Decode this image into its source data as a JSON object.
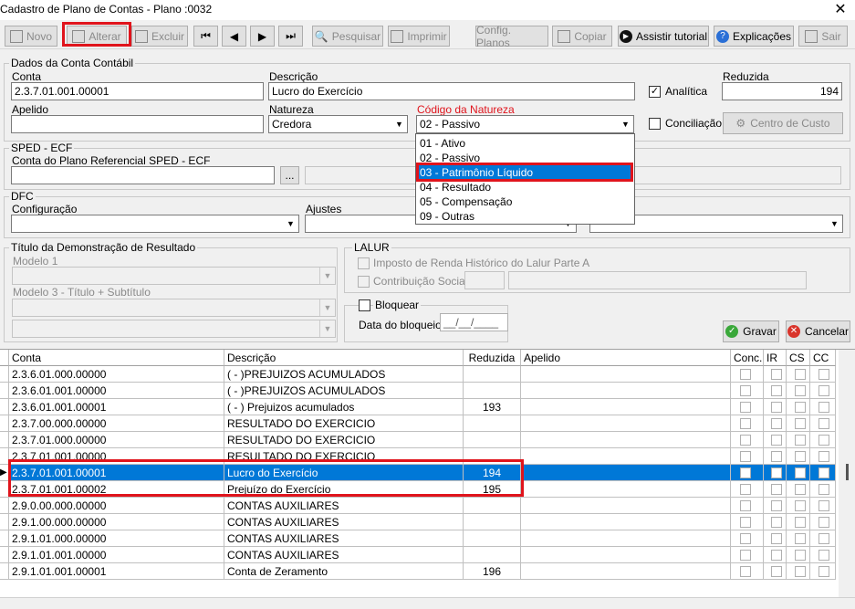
{
  "window": {
    "title": "Cadastro de Plano de Contas - Plano :0032"
  },
  "toolbar": {
    "novo": "Novo",
    "alterar": "Alterar",
    "excluir": "Excluir",
    "pesquisar": "Pesquisar",
    "imprimir": "Imprimir",
    "config": "Config. Planos",
    "copiar": "Copiar",
    "tutorial": "Assistir tutorial",
    "explicacoes": "Explicações",
    "sair": "Sair"
  },
  "dados": {
    "group": "Dados da Conta Contábil",
    "conta_label": "Conta",
    "conta": "2.3.7.01.001.00001",
    "descricao_label": "Descrição",
    "descricao": "Lucro do Exercício",
    "reduzida_label": "Reduzida",
    "reduzida": "194",
    "analitica_label": "Analítica",
    "apelido_label": "Apelido",
    "apelido": "",
    "natureza_label": "Natureza",
    "natureza": "Credora",
    "codigo_label": "Código da Natureza",
    "codigo": "02 - Passivo",
    "conciliacao_label": "Conciliação",
    "centro_custo": "Centro de Custo"
  },
  "dropdown": {
    "options": [
      "01 - Ativo",
      "02 - Passivo",
      "03 - Patrimônio Líquido",
      "04 - Resultado",
      "05 - Compensação",
      "09 - Outras"
    ]
  },
  "sped": {
    "group": "SPED - ECF",
    "label": "Conta do Plano Referencial SPED - ECF",
    "browse": "..."
  },
  "dfc": {
    "group": "DFC",
    "config_label": "Configuração",
    "ajustes_label": "Ajustes"
  },
  "titulo": {
    "group": "Título da Demonstração de Resultado",
    "modelo1": "Modelo 1",
    "modelo3": "Modelo 3 - Título + Subtítulo"
  },
  "lalur": {
    "group": "LALUR",
    "imposto": "Imposto de Renda",
    "historico": "Histórico do Lalur Parte A",
    "contribuicao": "Contribuição Social"
  },
  "bloqueio": {
    "label": "Bloquear",
    "data_label": "Data do bloqueio:",
    "data": "__/__/____"
  },
  "actions": {
    "gravar": "Gravar",
    "cancelar": "Cancelar"
  },
  "grid": {
    "headers": [
      "Conta",
      "Descrição",
      "Reduzida",
      "Apelido",
      "Conc.",
      "IR",
      "CS",
      "CC"
    ],
    "rows": [
      {
        "conta": "2.3.6.01.000.00000",
        "descricao": "( - )PREJUIZOS ACUMULADOS",
        "reduzida": ""
      },
      {
        "conta": "2.3.6.01.001.00000",
        "descricao": "( - )PREJUIZOS ACUMULADOS",
        "reduzida": ""
      },
      {
        "conta": "2.3.6.01.001.00001",
        "descricao": "( - ) Prejuizos acumulados",
        "reduzida": "193"
      },
      {
        "conta": "2.3.7.00.000.00000",
        "descricao": "RESULTADO DO EXERCICIO",
        "reduzida": ""
      },
      {
        "conta": "2.3.7.01.000.00000",
        "descricao": "RESULTADO DO EXERCICIO",
        "reduzida": ""
      },
      {
        "conta": "2.3.7.01.001.00000",
        "descricao": "RESULTADO DO EXERCICIO",
        "reduzida": ""
      },
      {
        "conta": "2.3.7.01.001.00001",
        "descricao": "Lucro do Exercício",
        "reduzida": "194"
      },
      {
        "conta": "2.3.7.01.001.00002",
        "descricao": "Prejuízo do Exercício",
        "reduzida": "195"
      },
      {
        "conta": "2.9.0.00.000.00000",
        "descricao": "CONTAS AUXILIARES",
        "reduzida": ""
      },
      {
        "conta": "2.9.1.00.000.00000",
        "descricao": "CONTAS AUXILIARES",
        "reduzida": ""
      },
      {
        "conta": "2.9.1.01.000.00000",
        "descricao": "CONTAS AUXILIARES",
        "reduzida": ""
      },
      {
        "conta": "2.9.1.01.001.00000",
        "descricao": "CONTAS AUXILIARES",
        "reduzida": ""
      },
      {
        "conta": "2.9.1.01.001.00001",
        "descricao": "Conta de Zeramento",
        "reduzida": "196"
      }
    ]
  },
  "colors": {
    "accent": "#0078d7",
    "highlight": "#e0141c"
  }
}
